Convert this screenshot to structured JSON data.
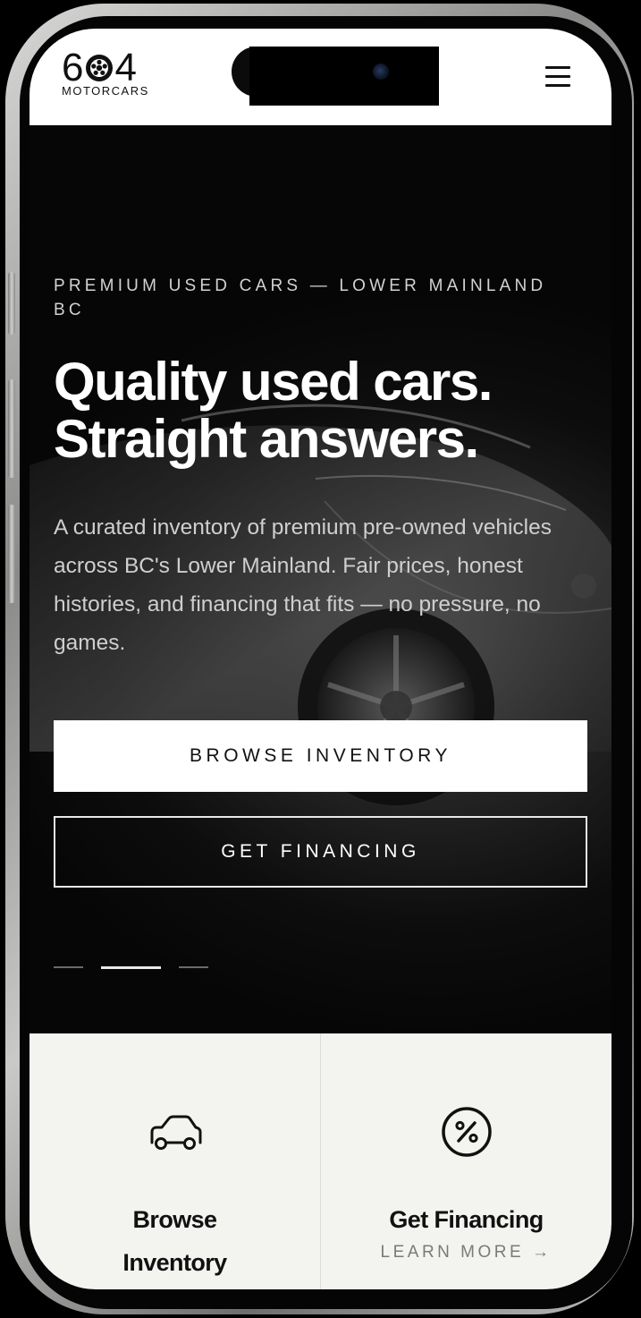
{
  "brand": {
    "logo_digits": [
      "6",
      "4"
    ],
    "logo_subtitle": "MOTORCARS"
  },
  "header": {
    "menu_icon": "hamburger-menu-icon"
  },
  "hero": {
    "eyebrow": "PREMIUM USED CARS — LOWER MAINLAND BC",
    "title_line1": "Quality used cars.",
    "title_line2": "Straight answers.",
    "description": "A curated inventory of premium pre-owned vehicles across BC's Lower Mainland. Fair prices, honest histories, and financing that fits — no pressure, no games.",
    "primary_button": "BROWSE INVENTORY",
    "secondary_button": "GET FINANCING",
    "slides": {
      "count": 3,
      "active_index": 1
    }
  },
  "features": [
    {
      "icon": "car-icon",
      "title_line1": "Browse",
      "title_line2": "Inventory"
    },
    {
      "icon": "percent-circle-icon",
      "title": "Get Financing",
      "link": "LEARN MORE →"
    }
  ],
  "colors": {
    "hero_background": "#060606",
    "header_background": "#ffffff",
    "features_background": "#f3f3f0",
    "text_light": "#cfcfcf",
    "link_muted": "#7a7a7a"
  }
}
